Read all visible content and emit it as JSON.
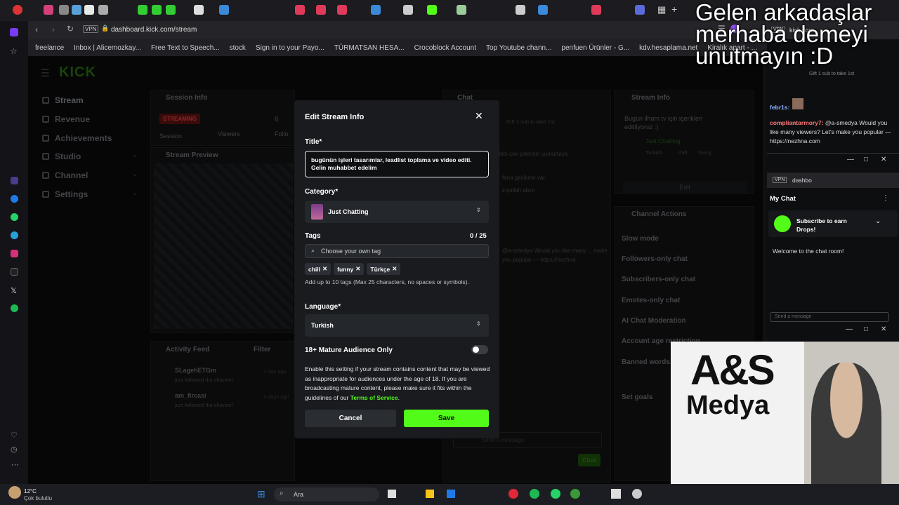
{
  "browser": {
    "url": "dashboard.kick.com/stream",
    "vpn_badge": "VPN",
    "bookmarks": [
      "freelance",
      "Inbox | Alicemozkay...",
      "Free Text to Speech...",
      "stock",
      "Sign in to your Payo...",
      "TÜRMATSAN HESA...",
      "Crocoblock Account",
      "Top Youtube chann...",
      "penfuen Ürünler - G...",
      "kdv.hesaplama.net",
      "Kiralık apart - ..."
    ]
  },
  "overlay_caption": {
    "line1": "Gelen arkadaşlar",
    "line2": "merhaba demeyi",
    "line3": "unutmayın :D"
  },
  "dashboard": {
    "logo": "KICK",
    "nav": [
      "Stream",
      "Revenue",
      "Achievements",
      "Studio",
      "Channel",
      "Settings"
    ],
    "session_info_title": "Session Info",
    "status_badge": "STREAMING",
    "session_label": "Session",
    "viewers_label": "Viewers",
    "followers_label": "Follo",
    "followers_value": "6",
    "stream_preview_title": "Stream Preview",
    "activity_feed_title": "Activity Feed",
    "filter_label": "Filter",
    "activity": [
      {
        "name": "SLagehETGm",
        "text": "just followed the channel",
        "time": "1 day ago"
      },
      {
        "name": "am_fircasi",
        "text": "just followed the channel",
        "time": "2 days ago"
      }
    ],
    "chat_title": "Chat",
    "chat_msgs": [
      "Gift 1 sub to take 1st",
      "Slots çok çirkinsin yumurtaya",
      "fena gecikme var",
      "inşallah abim",
      "@a-smedya Would you like many ... make you popular — https://nezhna"
    ],
    "chat_send_label": "Chat",
    "chat_placeholder": "Send a message",
    "stream_info_title": "Stream Info",
    "stream_info_text": "Bugün ilham tv için içerikleri editliyoruz :)",
    "stream_info_category": "Just Chatting",
    "stream_info_tags": [
      "Turkish",
      "chill",
      "funny"
    ],
    "edit_label": "Edit",
    "channel_actions_title": "Channel Actions",
    "actions": [
      "Slow mode",
      "Followers-only chat",
      "Subscribers-only chat",
      "Emotes-only chat",
      "AI Chat Moderation",
      "Account age restriction",
      "Banned words",
      "Set goals"
    ]
  },
  "modal": {
    "title": "Edit Stream Info",
    "title_label": "Title*",
    "title_value": "bugünün işleri tasarımlar, leadlist toplama ve video editi. Gelin muhabbet edelim",
    "category_label": "Category*",
    "category_value": "Just Chatting",
    "tags_label": "Tags",
    "tags_count": "0 / 25",
    "tags_placeholder": "Choose your own tag",
    "tags": [
      "chill",
      "funny",
      "Türkçe"
    ],
    "tags_help": "Add up to 10 tags (Max 25 characters, no spaces or symbols).",
    "language_label": "Language*",
    "language_value": "Turkish",
    "mature_label": "18+ Mature Audience Only",
    "mature_help": "Enable this setting if your stream contains content that may be viewed as inappropriate for audiences under the age of 18. If you are broadcasting mature content, please make sure it fits within the guidelines of our",
    "tos_link": "Terms of Service",
    "cancel_label": "Cancel",
    "save_label": "Save",
    "accent": "#53fc18"
  },
  "popout_chat": {
    "url": "kick.com",
    "gift_text": "Gift 1 sub to take 1st",
    "user1": "febr1s:",
    "user2": "compliantarmory7:",
    "msg2": "@a-smedya Would you like many viewers? Let's make you popular — https://nezhna.com",
    "url2": "dashbo",
    "my_chat": "My Chat",
    "drops_title": "Subscribe to earn Drops!",
    "welcome": "Welcome to the chat room!",
    "send_placeholder": "Send a message"
  },
  "webcam": {
    "logo_line1": "A&S",
    "logo_line2": "Medya"
  },
  "taskbar": {
    "weather_temp": "12°C",
    "weather_desc": "Çok bulutlu",
    "search_label": "Ara"
  }
}
